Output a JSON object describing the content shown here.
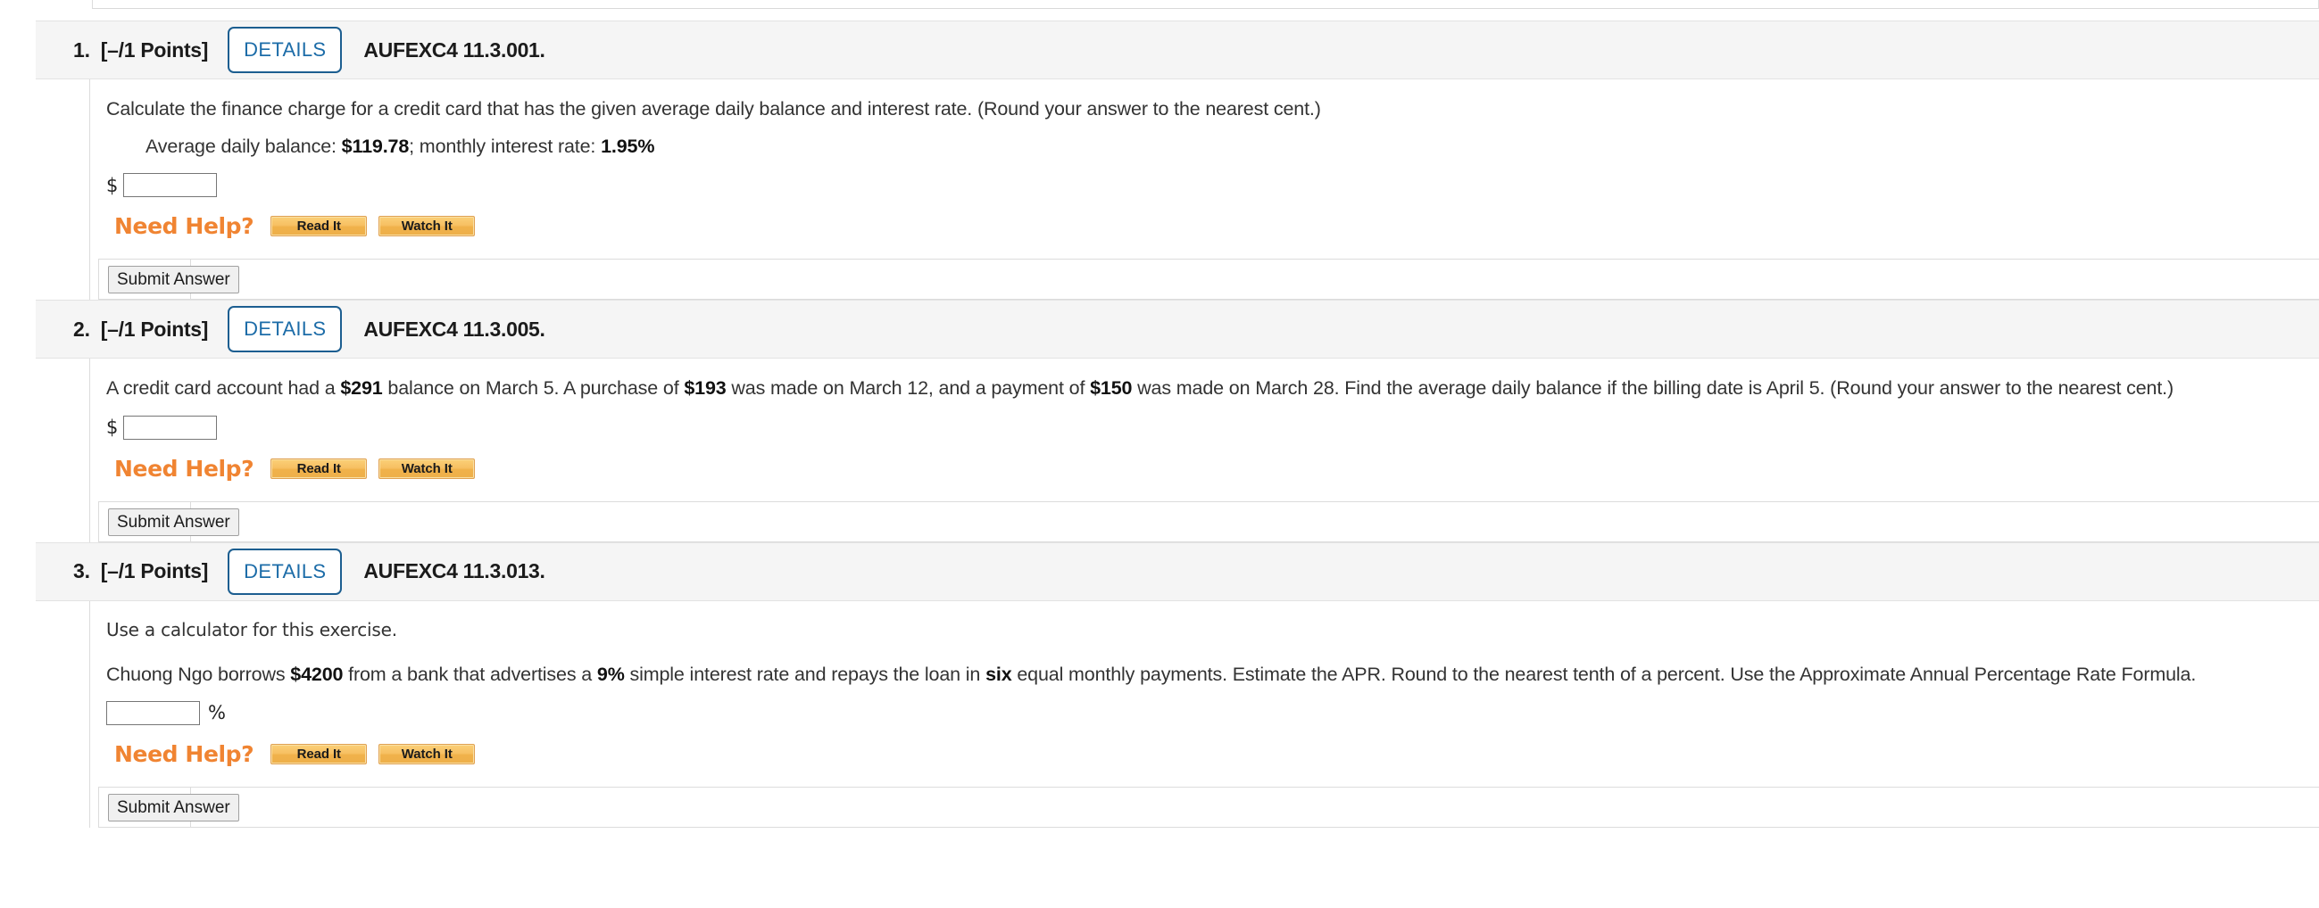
{
  "meta": {
    "accent_blue": "#1c6ca8",
    "need_help_orange": "#f08432",
    "help_button_gold": "#f7c063",
    "header_bg": "#f5f5f5"
  },
  "labels": {
    "details": "DETAILS",
    "need_help": "Need Help?",
    "read_it": "Read It",
    "watch_it": "Watch It",
    "submit_answer": "Submit Answer",
    "dollar_sign": "$",
    "percent_sign": "%",
    "input_placeholder": ""
  },
  "questions": [
    {
      "number": "1.",
      "points": "[–/1 Points]",
      "code": "AUFEXC4 11.3.001.",
      "prompt": "Calculate the finance charge for a credit card that has the given average daily balance and interest rate. (Round your answer to the nearest cent.)",
      "subline_prefix": "Average daily balance: ",
      "subline_value1": "$119.78",
      "subline_mid": "; monthly interest rate: ",
      "subline_value2": "1.95%",
      "answer_unit": "dollar",
      "answer_value": ""
    },
    {
      "number": "2.",
      "points": "[–/1 Points]",
      "code": "AUFEXC4 11.3.005.",
      "prompt_parts": [
        {
          "t": "A credit card account had a ",
          "b": false
        },
        {
          "t": "$291",
          "b": true
        },
        {
          "t": " balance on March 5. A purchase of ",
          "b": false
        },
        {
          "t": "$193",
          "b": true
        },
        {
          "t": " was made on March 12, and a payment of ",
          "b": false
        },
        {
          "t": "$150",
          "b": true
        },
        {
          "t": " was made on March 28. Find the average daily balance if the billing date is April 5. (Round your answer to the nearest cent.)",
          "b": false
        }
      ],
      "answer_unit": "dollar",
      "answer_value": ""
    },
    {
      "number": "3.",
      "points": "[–/1 Points]",
      "code": "AUFEXC4 11.3.013.",
      "intro": "Use a calculator for this exercise.",
      "prompt_parts": [
        {
          "t": "Chuong Ngo borrows ",
          "b": false
        },
        {
          "t": "$4200",
          "b": true
        },
        {
          "t": " from a bank that advertises a ",
          "b": false
        },
        {
          "t": "9%",
          "b": true
        },
        {
          "t": " simple interest rate and repays the loan in ",
          "b": false
        },
        {
          "t": "six",
          "b": true
        },
        {
          "t": " equal monthly payments. Estimate the APR. Round to the nearest tenth of a percent. Use the Approximate Annual Percentage Rate Formula.",
          "b": false
        }
      ],
      "answer_unit": "percent",
      "answer_value": ""
    }
  ]
}
